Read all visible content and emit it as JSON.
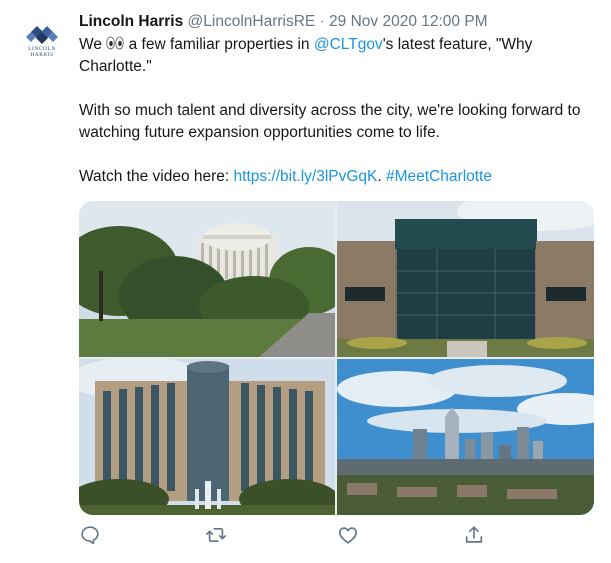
{
  "tweet": {
    "author": {
      "name": "Lincoln Harris",
      "handle": "@LincolnHarrisRE",
      "avatar_text_line1": "LINCOLN",
      "avatar_text_line2": "HARRIS"
    },
    "separator": "·",
    "timestamp": "29 Nov 2020 12:00 PM",
    "text": {
      "p1_before_emoji": "We",
      "p1_emoji": "eyes-emoji",
      "p1_mid": " a few familiar properties in ",
      "p1_mention": "@CLTgov",
      "p1_after": "'s latest feature, \"Why Charlotte.\"",
      "p2": "With so much talent and diversity across the city, we're looking forward to watching future expansion opportunities come to life.",
      "p3_before": "Watch the video here: ",
      "p3_url": "https://bit.ly/3lPvGqK",
      "p3_mid": ". ",
      "p3_hashtag": "#MeetCharlotte"
    },
    "media": [
      {
        "name": "domed-office-building-photo"
      },
      {
        "name": "glass-office-building-photo"
      },
      {
        "name": "tall-office-tower-fountain-photo"
      },
      {
        "name": "charlotte-skyline-photo"
      }
    ],
    "actions": [
      {
        "name": "reply-button",
        "icon": "reply-icon"
      },
      {
        "name": "retweet-button",
        "icon": "retweet-icon"
      },
      {
        "name": "like-button",
        "icon": "heart-icon"
      },
      {
        "name": "share-button",
        "icon": "share-icon"
      }
    ],
    "colors": {
      "link": "#1b95e0",
      "secondary_text": "#657786",
      "icon": "#657786",
      "logo_blue": "#2f4a7c"
    }
  }
}
